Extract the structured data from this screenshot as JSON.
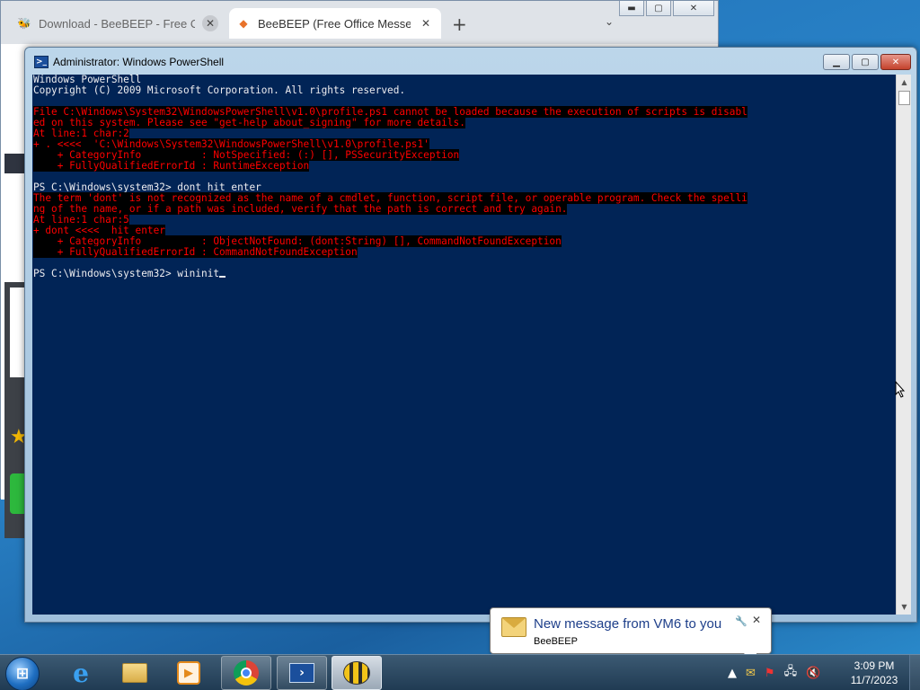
{
  "browser": {
    "tabs": [
      {
        "title": "Download - BeeBEEP - Free Office",
        "active": false,
        "icon": "beebeep-tab-icon"
      },
      {
        "title": "BeeBEEP (Free Office Messenger",
        "active": true,
        "icon": "beebeep-diamond-icon"
      }
    ],
    "new_tab_glyph": "+",
    "dropdown_glyph": "⌄"
  },
  "powershell": {
    "title": "Administrator: Windows PowerShell",
    "lines": [
      {
        "text": "Windows PowerShell",
        "error": false
      },
      {
        "text": "Copyright (C) 2009 Microsoft Corporation. All rights reserved.",
        "error": false
      },
      {
        "text": "",
        "error": false
      },
      {
        "text": "File C:\\Windows\\System32\\WindowsPowerShell\\v1.0\\profile.ps1 cannot be loaded because the execution of scripts is disabl",
        "error": true
      },
      {
        "text": "ed on this system. Please see \"get-help about_signing\" for more details.",
        "error": true
      },
      {
        "text": "At line:1 char:2",
        "error": true
      },
      {
        "text": "+ . <<<<  'C:\\Windows\\System32\\WindowsPowerShell\\v1.0\\profile.ps1'",
        "error": true
      },
      {
        "text": "    + CategoryInfo          : NotSpecified: (:) [], PSSecurityException",
        "error": true
      },
      {
        "text": "    + FullyQualifiedErrorId : RuntimeException",
        "error": true
      },
      {
        "text": "",
        "error": false
      },
      {
        "text": "PS C:\\Windows\\system32> dont hit enter",
        "error": false
      },
      {
        "text": "The term 'dont' is not recognized as the name of a cmdlet, function, script file, or operable program. Check the spelli",
        "error": true
      },
      {
        "text": "ng of the name, or if a path was included, verify that the path is correct and try again.",
        "error": true
      },
      {
        "text": "At line:1 char:5",
        "error": true
      },
      {
        "text": "+ dont <<<<  hit enter",
        "error": true
      },
      {
        "text": "    + CategoryInfo          : ObjectNotFound: (dont:String) [], CommandNotFoundException",
        "error": true
      },
      {
        "text": "    + FullyQualifiedErrorId : CommandNotFoundException",
        "error": true
      },
      {
        "text": "",
        "error": false
      }
    ],
    "prompt": "PS C:\\Windows\\system32> ",
    "current_input": "wininit"
  },
  "notification": {
    "title": "New message from VM6 to you",
    "app": "BeeBEEP"
  },
  "taskbar": {
    "apps": [
      {
        "name": "internet-explorer",
        "state": "pinned"
      },
      {
        "name": "file-explorer",
        "state": "pinned"
      },
      {
        "name": "media-player",
        "state": "pinned"
      },
      {
        "name": "chrome",
        "state": "open"
      },
      {
        "name": "powershell",
        "state": "open"
      },
      {
        "name": "beebeep",
        "state": "active"
      }
    ],
    "clock_time": "3:09 PM",
    "clock_date": "11/7/2023"
  }
}
